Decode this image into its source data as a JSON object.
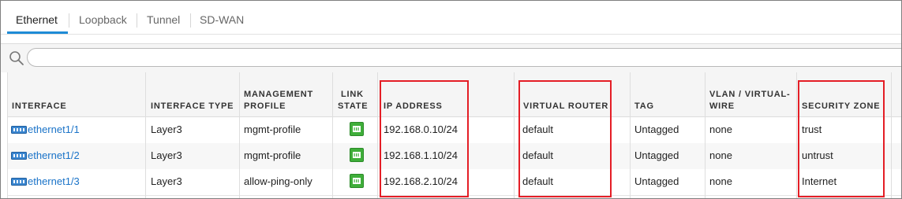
{
  "tabs": [
    {
      "label": "Ethernet",
      "active": true
    },
    {
      "label": "Loopback",
      "active": false
    },
    {
      "label": "Tunnel",
      "active": false
    },
    {
      "label": "SD-WAN",
      "active": false
    }
  ],
  "search": {
    "placeholder": "",
    "value": ""
  },
  "table": {
    "headers": {
      "interface": "INTERFACE",
      "interface_type": "INTERFACE TYPE",
      "management_profile_1": "MANAGEMENT",
      "management_profile_2": "PROFILE",
      "link_state_1": "LINK",
      "link_state_2": "STATE",
      "ip_address": "IP ADDRESS",
      "virtual_router": "VIRTUAL ROUTER",
      "tag": "TAG",
      "vlan_1": "VLAN / VIRTUAL-",
      "vlan_2": "WIRE",
      "security_zone": "SECURITY ZONE"
    },
    "rows": [
      {
        "interface": "ethernet1/1",
        "type": "Layer3",
        "profile": "mgmt-profile",
        "link_state": "up",
        "ip": "192.168.0.10/24",
        "router": "default",
        "tag": "Untagged",
        "vlan": "none",
        "zone": "trust"
      },
      {
        "interface": "ethernet1/2",
        "type": "Layer3",
        "profile": "mgmt-profile",
        "link_state": "up",
        "ip": "192.168.1.10/24",
        "router": "default",
        "tag": "Untagged",
        "vlan": "none",
        "zone": "untrust"
      },
      {
        "interface": "ethernet1/3",
        "type": "Layer3",
        "profile": "allow-ping-only",
        "link_state": "up",
        "ip": "192.168.2.10/24",
        "router": "default",
        "tag": "Untagged",
        "vlan": "none",
        "zone": "Internet"
      }
    ]
  },
  "colors": {
    "accent": "#1e8bd6",
    "link": "#1a73c8",
    "link_state_up": "#3fae3a",
    "highlight": "#e41e26"
  },
  "icons": {
    "search": "search-icon",
    "interface": "ethernet-port-icon",
    "link_state": "link-up-icon"
  }
}
